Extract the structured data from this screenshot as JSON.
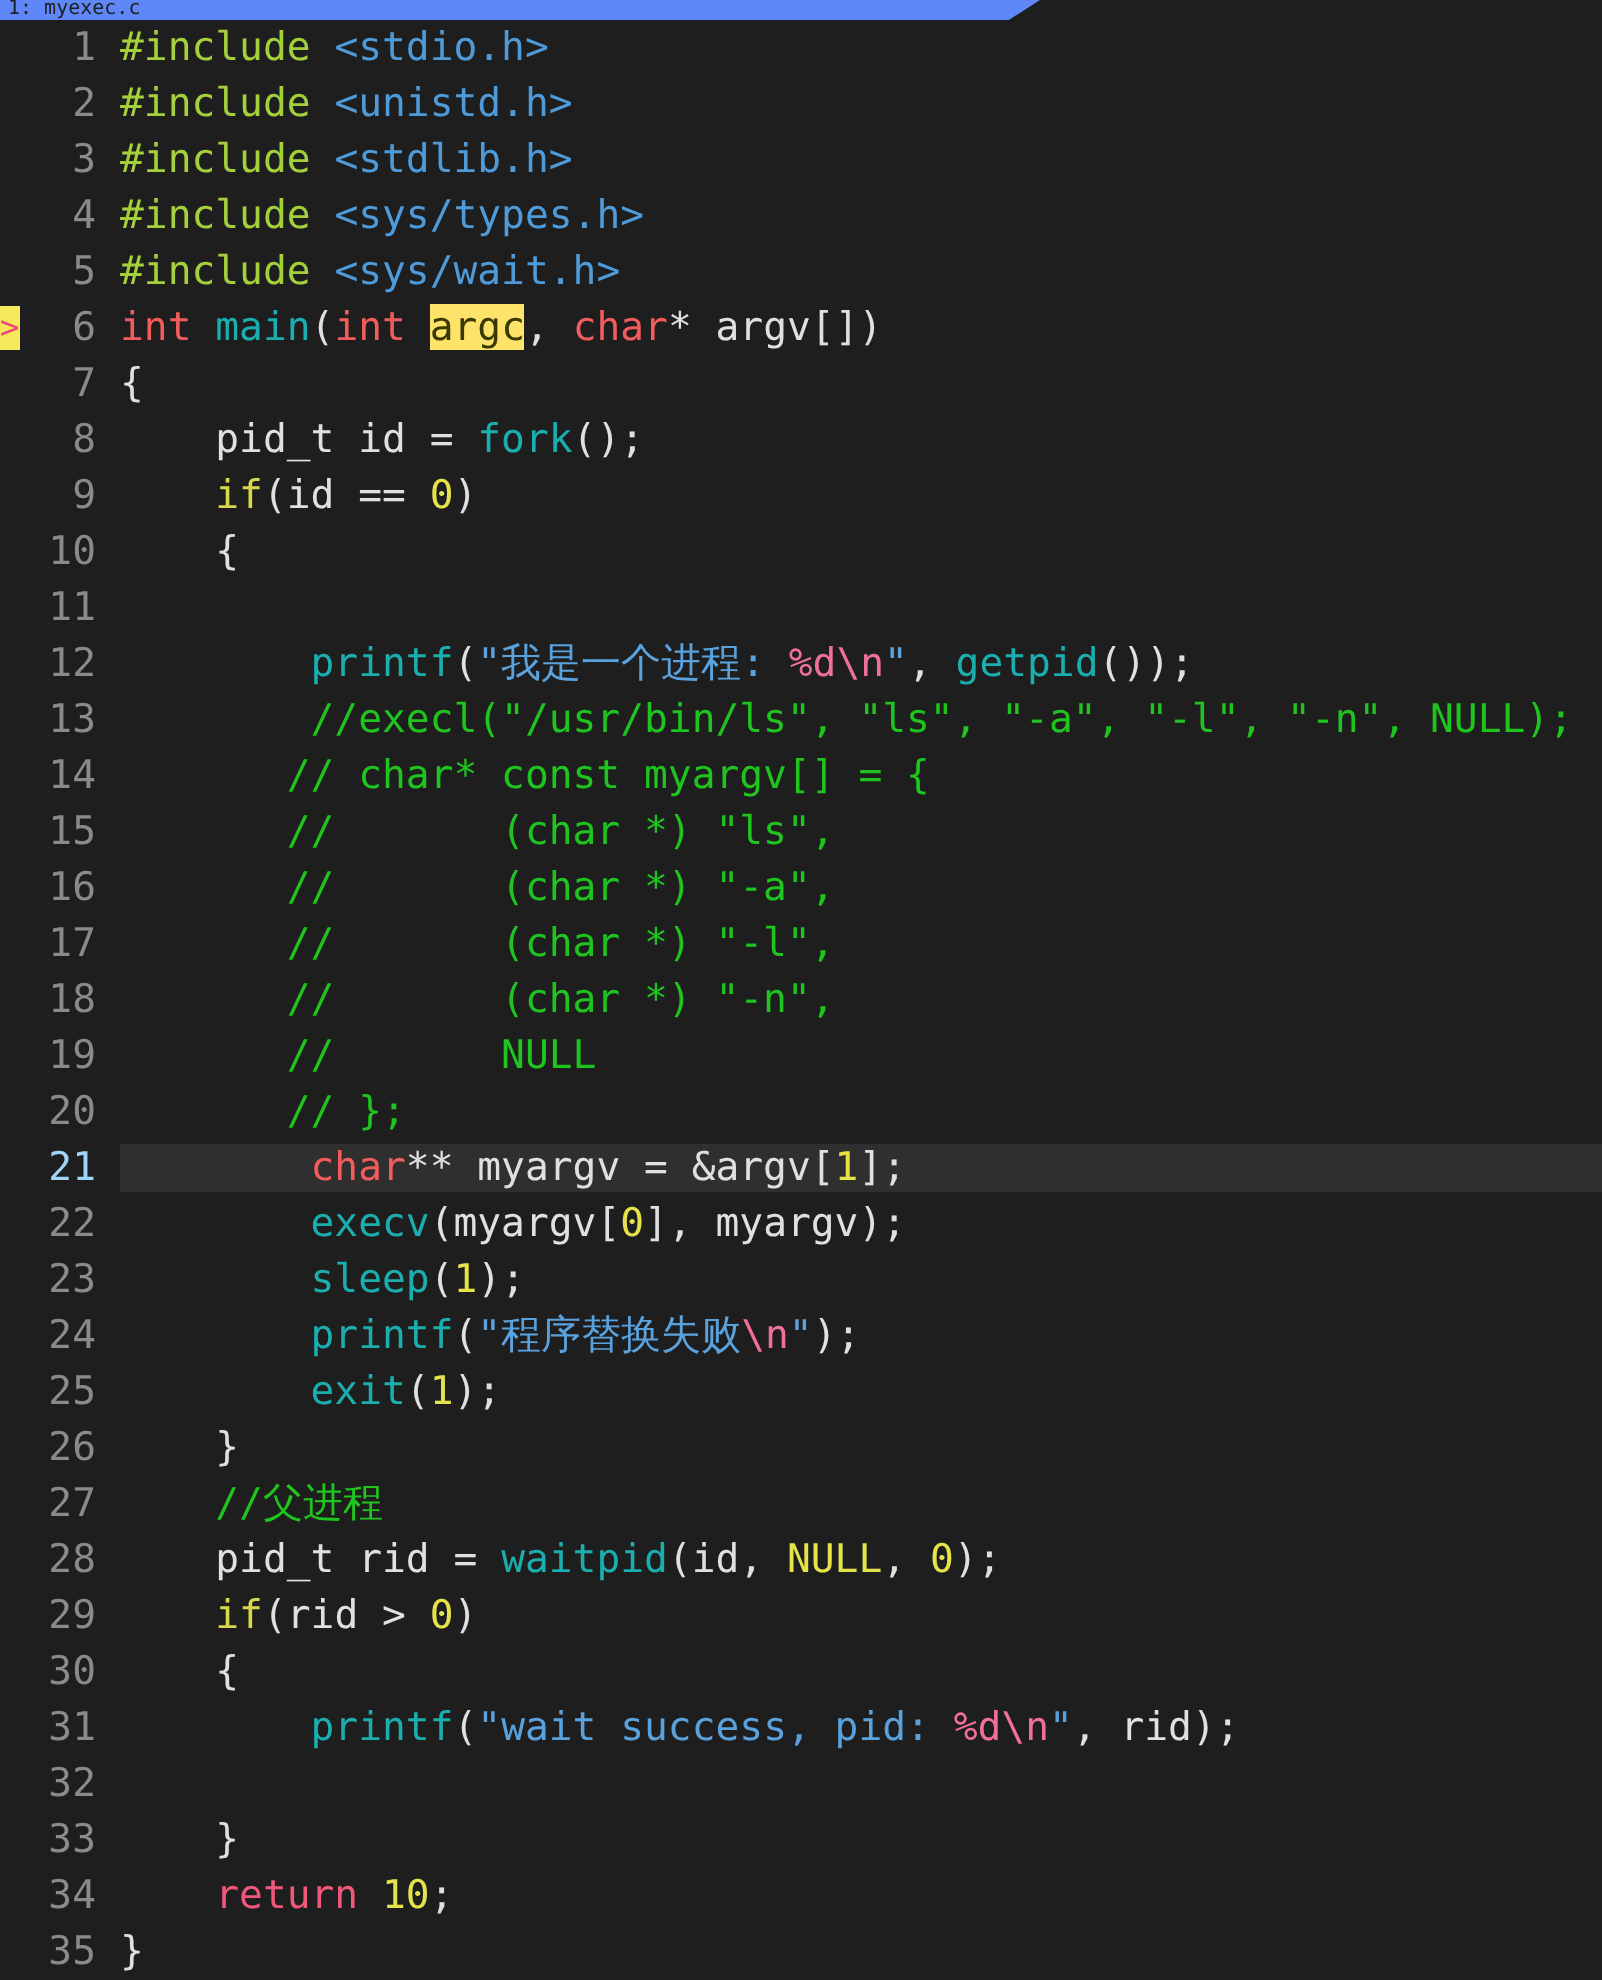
{
  "tab": {
    "label": "1: myexec.c",
    "selected": true
  },
  "lines": [
    {
      "number": "1",
      "current": false,
      "tokens": [
        {
          "kind": "preproc",
          "text": "#include "
        },
        {
          "kind": "header",
          "text": "<stdio.h>"
        }
      ]
    },
    {
      "number": "2",
      "current": false,
      "tokens": [
        {
          "kind": "preproc",
          "text": "#include "
        },
        {
          "kind": "header",
          "text": "<unistd.h>"
        }
      ]
    },
    {
      "number": "3",
      "current": false,
      "tokens": [
        {
          "kind": "preproc",
          "text": "#include "
        },
        {
          "kind": "header",
          "text": "<stdlib.h>"
        }
      ]
    },
    {
      "number": "4",
      "current": false,
      "tokens": [
        {
          "kind": "preproc",
          "text": "#include "
        },
        {
          "kind": "header",
          "text": "<sys/types.h>"
        }
      ]
    },
    {
      "number": "5",
      "current": false,
      "tokens": [
        {
          "kind": "preproc",
          "text": "#include "
        },
        {
          "kind": "header",
          "text": "<sys/wait.h>"
        }
      ]
    },
    {
      "number": "6",
      "current": false,
      "marker": ">",
      "tokens": [
        {
          "kind": "type",
          "text": "int "
        },
        {
          "kind": "func",
          "text": "main"
        },
        {
          "kind": "plain",
          "text": "("
        },
        {
          "kind": "type",
          "text": "int "
        },
        {
          "kind": "match",
          "text": "argc"
        },
        {
          "kind": "plain",
          "text": ", "
        },
        {
          "kind": "type",
          "text": "char"
        },
        {
          "kind": "plain",
          "text": "* argv[])"
        }
      ]
    },
    {
      "number": "7",
      "current": false,
      "tokens": [
        {
          "kind": "plain",
          "text": "{"
        }
      ]
    },
    {
      "number": "8",
      "current": false,
      "tokens": [
        {
          "kind": "plain",
          "text": "    pid_t id = "
        },
        {
          "kind": "func",
          "text": "fork"
        },
        {
          "kind": "plain",
          "text": "();"
        }
      ]
    },
    {
      "number": "9",
      "current": false,
      "tokens": [
        {
          "kind": "cond",
          "text": "    if"
        },
        {
          "kind": "plain",
          "text": "(id == "
        },
        {
          "kind": "number",
          "text": "0"
        },
        {
          "kind": "plain",
          "text": ")"
        }
      ]
    },
    {
      "number": "10",
      "current": false,
      "tokens": [
        {
          "kind": "plain",
          "text": "    {"
        }
      ]
    },
    {
      "number": "11",
      "current": false
    },
    {
      "number": "12",
      "current": false,
      "tokens": [
        {
          "kind": "func",
          "text": "        printf"
        },
        {
          "kind": "plain",
          "text": "("
        },
        {
          "kind": "string",
          "text": "\"我是一个进程: "
        },
        {
          "kind": "escape",
          "text": "%d\\n"
        },
        {
          "kind": "string",
          "text": "\""
        },
        {
          "kind": "plain",
          "text": ", "
        },
        {
          "kind": "func",
          "text": "getpid"
        },
        {
          "kind": "plain",
          "text": "());"
        }
      ]
    },
    {
      "number": "13",
      "current": false,
      "tokens": [
        {
          "kind": "comment",
          "text": "        //execl(\"/usr/bin/ls\", \"ls\", \"-a\", \"-l\", \"-n\", NULL);"
        }
      ]
    },
    {
      "number": "14",
      "current": false,
      "tokens": [
        {
          "kind": "comment",
          "text": "       // char* const myargv[] = {"
        }
      ]
    },
    {
      "number": "15",
      "current": false,
      "tokens": [
        {
          "kind": "comment",
          "text": "       //       (char *) \"ls\","
        }
      ]
    },
    {
      "number": "16",
      "current": false,
      "tokens": [
        {
          "kind": "comment",
          "text": "       //       (char *) \"-a\","
        }
      ]
    },
    {
      "number": "17",
      "current": false,
      "tokens": [
        {
          "kind": "comment",
          "text": "       //       (char *) \"-l\","
        }
      ]
    },
    {
      "number": "18",
      "current": false,
      "tokens": [
        {
          "kind": "comment",
          "text": "       //       (char *) \"-n\","
        }
      ]
    },
    {
      "number": "19",
      "current": false,
      "tokens": [
        {
          "kind": "comment",
          "text": "       //       NULL"
        }
      ]
    },
    {
      "number": "20",
      "current": false,
      "tokens": [
        {
          "kind": "comment",
          "text": "       // };"
        }
      ]
    },
    {
      "number": "21",
      "current": true,
      "tokens": [
        {
          "kind": "type",
          "text": "        char"
        },
        {
          "kind": "plain",
          "text": "** myargv = &argv["
        },
        {
          "kind": "number",
          "text": "1"
        },
        {
          "kind": "plain",
          "text": "];"
        }
      ]
    },
    {
      "number": "22",
      "current": false,
      "tokens": [
        {
          "kind": "func",
          "text": "        execv"
        },
        {
          "kind": "plain",
          "text": "(myargv["
        },
        {
          "kind": "number",
          "text": "0"
        },
        {
          "kind": "plain",
          "text": "], myargv);"
        }
      ]
    },
    {
      "number": "23",
      "current": false,
      "tokens": [
        {
          "kind": "func",
          "text": "        sleep"
        },
        {
          "kind": "plain",
          "text": "("
        },
        {
          "kind": "number",
          "text": "1"
        },
        {
          "kind": "plain",
          "text": ");"
        }
      ]
    },
    {
      "number": "24",
      "current": false,
      "tokens": [
        {
          "kind": "func",
          "text": "        printf"
        },
        {
          "kind": "plain",
          "text": "("
        },
        {
          "kind": "string",
          "text": "\"程序替换失败"
        },
        {
          "kind": "escape",
          "text": "\\n"
        },
        {
          "kind": "string",
          "text": "\""
        },
        {
          "kind": "plain",
          "text": ");"
        }
      ]
    },
    {
      "number": "25",
      "current": false,
      "tokens": [
        {
          "kind": "func",
          "text": "        exit"
        },
        {
          "kind": "plain",
          "text": "("
        },
        {
          "kind": "number",
          "text": "1"
        },
        {
          "kind": "plain",
          "text": ");"
        }
      ]
    },
    {
      "number": "26",
      "current": false,
      "tokens": [
        {
          "kind": "plain",
          "text": "    }"
        }
      ]
    },
    {
      "number": "27",
      "current": false,
      "tokens": [
        {
          "kind": "comment",
          "text": "    //父进程"
        }
      ]
    },
    {
      "number": "28",
      "current": false,
      "tokens": [
        {
          "kind": "plain",
          "text": "    pid_t rid = "
        },
        {
          "kind": "func",
          "text": "waitpid"
        },
        {
          "kind": "plain",
          "text": "(id, "
        },
        {
          "kind": "number",
          "text": "NULL"
        },
        {
          "kind": "plain",
          "text": ", "
        },
        {
          "kind": "number",
          "text": "0"
        },
        {
          "kind": "plain",
          "text": ");"
        }
      ]
    },
    {
      "number": "29",
      "current": false,
      "tokens": [
        {
          "kind": "cond",
          "text": "    if"
        },
        {
          "kind": "plain",
          "text": "(rid > "
        },
        {
          "kind": "number",
          "text": "0"
        },
        {
          "kind": "plain",
          "text": ")"
        }
      ]
    },
    {
      "number": "30",
      "current": false,
      "tokens": [
        {
          "kind": "plain",
          "text": "    {"
        }
      ]
    },
    {
      "number": "31",
      "current": false,
      "tokens": [
        {
          "kind": "func",
          "text": "        printf"
        },
        {
          "kind": "plain",
          "text": "("
        },
        {
          "kind": "string",
          "text": "\"wait success, pid: "
        },
        {
          "kind": "escape",
          "text": "%d\\n"
        },
        {
          "kind": "string",
          "text": "\""
        },
        {
          "kind": "plain",
          "text": ", rid);"
        }
      ]
    },
    {
      "number": "32",
      "current": false
    },
    {
      "number": "33",
      "current": false,
      "tokens": [
        {
          "kind": "plain",
          "text": "    }"
        }
      ]
    },
    {
      "number": "34",
      "current": false,
      "tokens": [
        {
          "kind": "keyword",
          "text": "    return"
        },
        {
          "kind": "number",
          "text": " 10"
        },
        {
          "kind": "plain",
          "text": ";"
        }
      ]
    },
    {
      "number": "35",
      "current": false,
      "tokens": [
        {
          "kind": "plain",
          "text": "}"
        }
      ]
    }
  ]
}
